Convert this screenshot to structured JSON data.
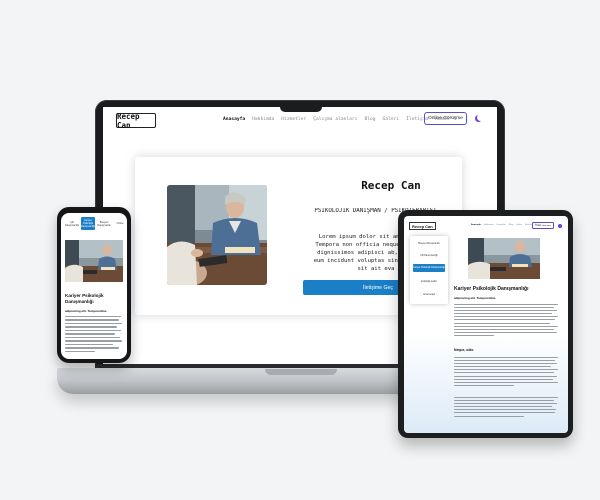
{
  "laptop": {
    "logo": "Recep Can",
    "nav": [
      "Anasayfa",
      "Hakkımda",
      "Hizmetler",
      "Çalışma alanları",
      "Blog",
      "Galeri",
      "İletişim",
      "Admin"
    ],
    "cta": "Online Görüşme",
    "hero": {
      "name": "Recep Can",
      "subtitle": "PSİKOLOJİK DANIŞMAN / PSİKOTERAPİST",
      "lorem_lines": [
        "Lorem ipsum dolor sit amet consect",
        "Tempora non officia neque blandiitis",
        "dignissimos adipisci ab, voluptatum",
        "eum incidunt voluptas sint repudianda",
        "sit ait eva"
      ],
      "button": "İletişime Geç"
    }
  },
  "phone": {
    "tabs": [
      "Çift Danışmanlığı",
      "Kariyer Psikolojik Danışmanlığı",
      "Bireysel Danışmanlık",
      "Online"
    ],
    "title": "Kariyer Psikolojik Danışmanlığı",
    "subtitle": "adipisicing elit. Tempore/Hus."
  },
  "tablet": {
    "logo": "Recep Can",
    "nav": [
      "Anasayfa",
      "Hakkımda",
      "Hizmetler",
      "Blog",
      "Galeri",
      "İletişim",
      "Admin"
    ],
    "cta": "Online Görüşme",
    "dropdown": [
      "Bireysel Danışmanlık",
      "Çift Danışmanlığı",
      "Kariyer Psikolojik Danışmanlığı",
      "psikolojik testler",
      "cinsel terapi"
    ],
    "title": "Kariyer Psikolojik Danışmanlığı",
    "subtitle": "adipisicing elit. Tempore/Hus.",
    "section_heading": "Neque, odio"
  },
  "colors": {
    "accent": "#1a7fc7",
    "cta_border": "#5a4fc9",
    "moon": "#6b3fe0",
    "background": "#f3f4f5"
  }
}
